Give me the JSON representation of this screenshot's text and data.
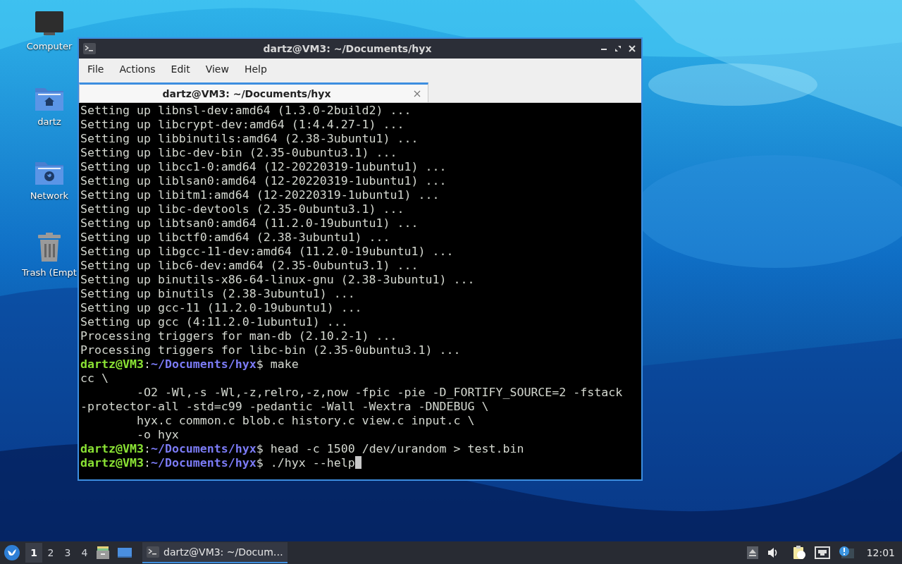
{
  "desktop": {
    "icons": [
      {
        "kind": "computer",
        "label": "Computer"
      },
      {
        "kind": "home",
        "label": "dartz"
      },
      {
        "kind": "network",
        "label": "Network"
      },
      {
        "kind": "trash",
        "label": "Trash (Empt"
      }
    ]
  },
  "window": {
    "title": "dartz@VM3: ~/Documents/hyx",
    "menu": [
      "File",
      "Actions",
      "Edit",
      "View",
      "Help"
    ],
    "tabs": [
      {
        "label": "dartz@VM3: ~/Documents/hyx",
        "selected": true
      }
    ],
    "terminal": {
      "cursor": true,
      "lines": [
        {
          "kind": "output",
          "text": "Setting up libnsl-dev:amd64 (1.3.0-2build2) ..."
        },
        {
          "kind": "output",
          "text": "Setting up libcrypt-dev:amd64 (1:4.4.27-1) ..."
        },
        {
          "kind": "output",
          "text": "Setting up libbinutils:amd64 (2.38-3ubuntu1) ..."
        },
        {
          "kind": "output",
          "text": "Setting up libc-dev-bin (2.35-0ubuntu3.1) ..."
        },
        {
          "kind": "output",
          "text": "Setting up libcc1-0:amd64 (12-20220319-1ubuntu1) ..."
        },
        {
          "kind": "output",
          "text": "Setting up liblsan0:amd64 (12-20220319-1ubuntu1) ..."
        },
        {
          "kind": "output",
          "text": "Setting up libitm1:amd64 (12-20220319-1ubuntu1) ..."
        },
        {
          "kind": "output",
          "text": "Setting up libc-devtools (2.35-0ubuntu3.1) ..."
        },
        {
          "kind": "output",
          "text": "Setting up libtsan0:amd64 (11.2.0-19ubuntu1) ..."
        },
        {
          "kind": "output",
          "text": "Setting up libctf0:amd64 (2.38-3ubuntu1) ..."
        },
        {
          "kind": "output",
          "text": "Setting up libgcc-11-dev:amd64 (11.2.0-19ubuntu1) ..."
        },
        {
          "kind": "output",
          "text": "Setting up libc6-dev:amd64 (2.35-0ubuntu3.1) ..."
        },
        {
          "kind": "output",
          "text": "Setting up binutils-x86-64-linux-gnu (2.38-3ubuntu1) ..."
        },
        {
          "kind": "output",
          "text": "Setting up binutils (2.38-3ubuntu1) ..."
        },
        {
          "kind": "output",
          "text": "Setting up gcc-11 (11.2.0-19ubuntu1) ..."
        },
        {
          "kind": "output",
          "text": "Setting up gcc (4:11.2.0-1ubuntu1) ..."
        },
        {
          "kind": "output",
          "text": "Processing triggers for man-db (2.10.2-1) ..."
        },
        {
          "kind": "output",
          "text": "Processing triggers for libc-bin (2.35-0ubuntu3.1) ..."
        },
        {
          "kind": "prompt",
          "user": "dartz@VM3",
          "sep": ":",
          "path": "~/Documents/hyx",
          "command": "$ make"
        },
        {
          "kind": "output",
          "text": "cc \\"
        },
        {
          "kind": "output",
          "text": "        -O2 -Wl,-s -Wl,-z,relro,-z,now -fpic -pie -D_FORTIFY_SOURCE=2 -fstack"
        },
        {
          "kind": "output",
          "text": "-protector-all -std=c99 -pedantic -Wall -Wextra -DNDEBUG \\"
        },
        {
          "kind": "output",
          "text": "        hyx.c common.c blob.c history.c view.c input.c \\"
        },
        {
          "kind": "output",
          "text": "        -o hyx"
        },
        {
          "kind": "prompt",
          "user": "dartz@VM3",
          "sep": ":",
          "path": "~/Documents/hyx",
          "command": "$ head -c 1500 /dev/urandom > test.bin"
        },
        {
          "kind": "prompt",
          "user": "dartz@VM3",
          "sep": ":",
          "path": "~/Documents/hyx",
          "command": "$ ./hyx --help"
        }
      ]
    }
  },
  "taskbar": {
    "workspaces": [
      {
        "label": "1",
        "selected": true
      },
      {
        "label": "2",
        "selected": false
      },
      {
        "label": "3",
        "selected": false
      },
      {
        "label": "4",
        "selected": false
      }
    ],
    "tasks": [
      {
        "label": "dartz@VM3: ~/Docum…",
        "selected": true
      }
    ],
    "clock": "12:01"
  }
}
